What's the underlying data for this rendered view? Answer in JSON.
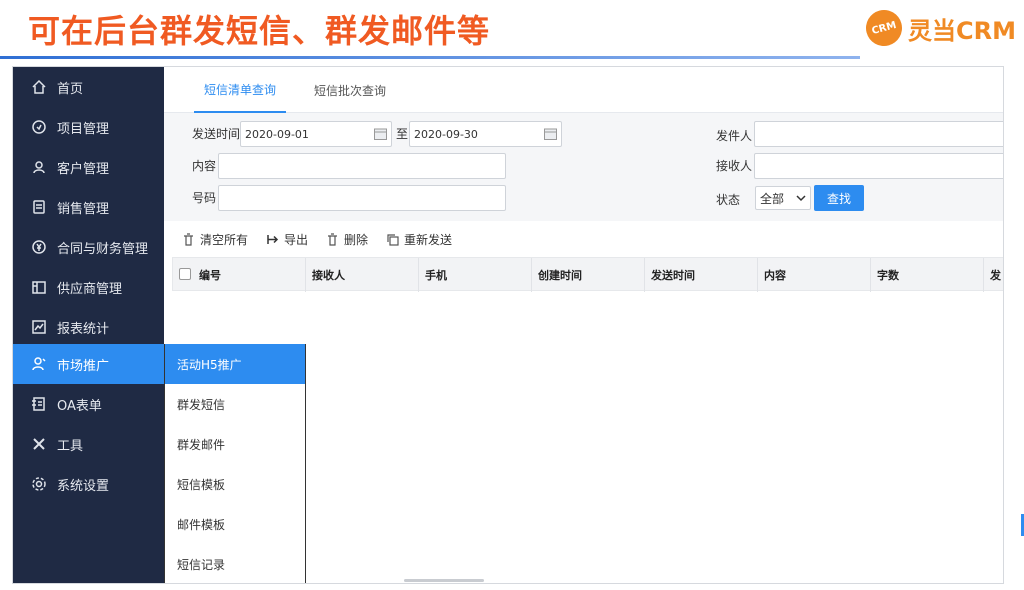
{
  "header": {
    "headline": "可在后台群发短信、群发邮件等",
    "brand_badge": "CRM",
    "brand_name": "灵当CRM",
    "accent_color": "#f05a22"
  },
  "sidebar": {
    "items": [
      {
        "label": "首页",
        "icon": "home-icon"
      },
      {
        "label": "项目管理",
        "icon": "project-icon"
      },
      {
        "label": "客户管理",
        "icon": "customer-icon"
      },
      {
        "label": "销售管理",
        "icon": "sales-icon"
      },
      {
        "label": "合同与财务管理",
        "icon": "finance-icon"
      },
      {
        "label": "供应商管理",
        "icon": "supplier-icon"
      },
      {
        "label": "报表统计",
        "icon": "report-icon"
      },
      {
        "label": "市场推广",
        "icon": "marketing-icon",
        "active": true
      },
      {
        "label": "OA表单",
        "icon": "form-icon"
      },
      {
        "label": "工具",
        "icon": "tools-icon"
      },
      {
        "label": "系统设置",
        "icon": "settings-icon"
      }
    ]
  },
  "submenu": {
    "items": [
      {
        "label": "活动H5推广",
        "active": true
      },
      {
        "label": "群发短信"
      },
      {
        "label": "群发邮件"
      },
      {
        "label": "短信模板"
      },
      {
        "label": "邮件模板"
      },
      {
        "label": "短信记录"
      }
    ]
  },
  "tabs": [
    {
      "label": "短信清单查询",
      "active": true
    },
    {
      "label": "短信批次查询"
    }
  ],
  "filters": {
    "send_time_label": "发送时间",
    "date_from": "2020-09-01",
    "date_to_sep": "至",
    "date_to": "2020-09-30",
    "content_label": "内容",
    "number_label": "号码",
    "sender_label": "发件人",
    "receiver_label": "接收人",
    "status_label": "状态",
    "status_value": "全部",
    "search_button": "查找"
  },
  "toolbar": {
    "clear_all": "清空所有",
    "export": "导出",
    "delete": "删除",
    "resend": "重新发送"
  },
  "table": {
    "columns": [
      "编号",
      "接收人",
      "手机",
      "创建时间",
      "发送时间",
      "内容",
      "字数",
      "发"
    ]
  },
  "colors": {
    "sidebar_bg": "#1f2a44",
    "primary": "#2d8cf0"
  }
}
